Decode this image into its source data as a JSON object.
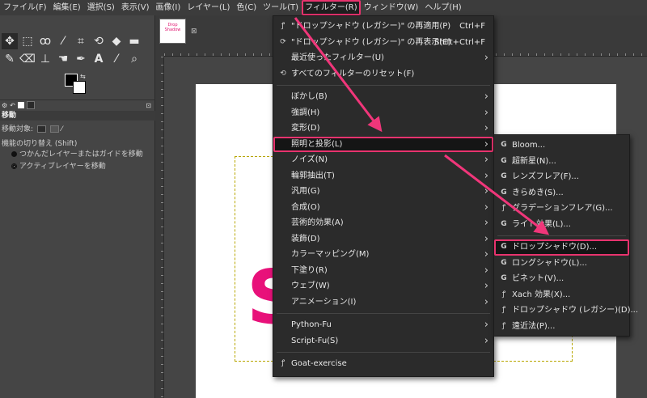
{
  "menubar": {
    "items": [
      "ファイル(F)",
      "編集(E)",
      "選択(S)",
      "表示(V)",
      "画像(I)",
      "レイヤー(L)",
      "色(C)",
      "ツール(T)",
      "フィルター(R)",
      "ウィンドウ(W)",
      "ヘルプ(H)"
    ],
    "active_index": 8
  },
  "toolbox": {
    "tool_icons": [
      "move-icon",
      "rect-select-icon",
      "lasso-icon",
      "fuzzy-select-icon",
      "crop-icon",
      "warp-icon",
      "bucket-icon",
      "paintbrush-icon",
      "eraser-icon",
      "clone-icon",
      "smudge-icon",
      "path-icon",
      "text-icon",
      "color-picker-icon",
      "zoom-icon"
    ],
    "options_title": "移動",
    "move_target_label": "移動対象:",
    "toggle_label": "機能の切り替え  (Shift)",
    "radio_1": "つかんだレイヤーまたはガイドを移動",
    "radio_2": "アクティブレイヤーを移動"
  },
  "image_tab": {
    "thumb_line1": "Drop",
    "thumb_line2": "Shadow",
    "close": "⊠"
  },
  "canvas": {
    "visible_text": "S",
    "text_color": "#e8117a"
  },
  "filters_menu": {
    "items": [
      {
        "label": "\"ドロップシャドウ (レガシー)\" の再適用(P)",
        "shortcut": "Ctrl+F",
        "icon": "reapply-icon"
      },
      {
        "label": "\"ドロップシャドウ (レガシー)\" の再表示(E)",
        "shortcut": "Shift+Ctrl+F",
        "icon": "reshow-icon"
      },
      {
        "label": "最近使ったフィルター(U)",
        "submenu": true
      },
      {
        "label": "すべてのフィルターのリセット(F)",
        "icon": "reset-icon"
      },
      {
        "sep": true
      },
      {
        "label": "ぼかし(B)",
        "submenu": true
      },
      {
        "label": "強調(H)",
        "submenu": true
      },
      {
        "label": "変形(D)",
        "submenu": true
      },
      {
        "label": "照明と投影(L)",
        "submenu": true,
        "highlight": true
      },
      {
        "label": "ノイズ(N)",
        "submenu": true
      },
      {
        "label": "輪郭抽出(T)",
        "submenu": true
      },
      {
        "label": "汎用(G)",
        "submenu": true
      },
      {
        "label": "合成(O)",
        "submenu": true
      },
      {
        "label": "芸術的効果(A)",
        "submenu": true
      },
      {
        "label": "装飾(D)",
        "submenu": true
      },
      {
        "label": "カラーマッピング(M)",
        "submenu": true
      },
      {
        "label": "下塗り(R)",
        "submenu": true
      },
      {
        "label": "ウェブ(W)",
        "submenu": true
      },
      {
        "label": "アニメーション(I)",
        "submenu": true
      },
      {
        "sep": true
      },
      {
        "label": "Python-Fu",
        "submenu": true
      },
      {
        "label": "Script-Fu(S)",
        "submenu": true
      },
      {
        "sep": true
      },
      {
        "label": "Goat-exercise",
        "icon": "plugin-icon"
      }
    ]
  },
  "light_shadow_menu": {
    "items": [
      {
        "label": "Bloom...",
        "icon": "gegl-icon"
      },
      {
        "label": "超新星(N)...",
        "icon": "gegl-icon"
      },
      {
        "label": "レンズフレア(F)...",
        "icon": "gegl-icon"
      },
      {
        "label": "きらめき(S)...",
        "icon": "gegl-icon"
      },
      {
        "label": "グラデーションフレア(G)...",
        "icon": "plugin-icon"
      },
      {
        "label": "ライト効果(L)...",
        "icon": "gegl-icon"
      },
      {
        "sep": true
      },
      {
        "label": "ドロップシャドウ(D)...",
        "icon": "gegl-icon",
        "highlight": true
      },
      {
        "label": "ロングシャドウ(L)...",
        "icon": "gegl-icon"
      },
      {
        "label": "ビネット(V)...",
        "icon": "gegl-icon"
      },
      {
        "label": "Xach 効果(X)...",
        "icon": "plugin-icon"
      },
      {
        "label": "ドロップシャドウ (レガシー)(D)...",
        "icon": "plugin-icon"
      },
      {
        "label": "遠近法(P)...",
        "icon": "plugin-icon"
      }
    ]
  },
  "colors": {
    "accent": "#e8336e",
    "menu_bg": "#2b2b2b"
  }
}
